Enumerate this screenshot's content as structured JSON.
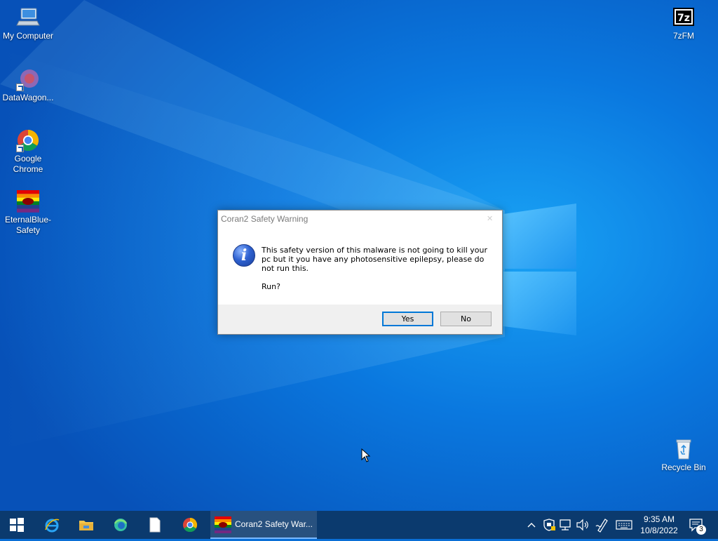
{
  "desktop": {
    "icons": [
      {
        "label": "My Computer",
        "icon": "computer-icon"
      },
      {
        "label": "DataWagon...",
        "icon": "datawagon-icon"
      },
      {
        "label": "Google Chrome",
        "icon": "chrome-icon"
      },
      {
        "label": "EternalBlue-Safety",
        "icon": "rainbow-flag-icon"
      },
      {
        "label": "7zFM",
        "icon": "7zip-icon",
        "glyph": "7z"
      },
      {
        "label": "Recycle Bin",
        "icon": "recycle-bin-icon"
      }
    ]
  },
  "dialog": {
    "title": "Coran2 Safety Warning",
    "message": "This safety version of this malware is not going to kill your pc but it you have any photosensitive epilepsy, please do not run this.",
    "question": "Run?",
    "yes_label": "Yes",
    "no_label": "No",
    "info_glyph": "i"
  },
  "taskbar": {
    "pinned": [
      "start-icon",
      "internet-explorer-icon",
      "file-explorer-icon",
      "edge-icon",
      "document-icon",
      "chrome-icon"
    ],
    "active_window": {
      "label": "Coran2 Safety War...",
      "icon": "rainbow-flag-icon"
    },
    "tray_icons": [
      "chevron-up-icon",
      "security-shield-icon",
      "network-icon",
      "volume-icon",
      "pen-icon",
      "keyboard-icon"
    ],
    "time": "9:35 AM",
    "date": "10/8/2022",
    "notification_count": "3"
  },
  "colors": {
    "desktop_blue": "#0a6fd6",
    "taskbar": "#0b3a6e",
    "accent": "#0078d7"
  }
}
